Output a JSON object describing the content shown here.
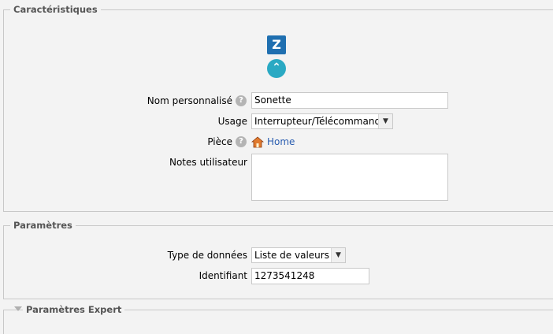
{
  "sections": {
    "caracteristiques": "Caractéristiques",
    "parametres": "Paramètres",
    "parametres_expert": "Paramètres Expert"
  },
  "icons": {
    "logo": "zibase-logo-icon",
    "collapse": "chevron-up-icon",
    "help": "help-icon",
    "room": "home-icon",
    "expand": "triangle-down-icon"
  },
  "colors": {
    "logo": "#1f6fb0",
    "collapse_button": "#2aa9c3",
    "link": "#2a5db0"
  },
  "form": {
    "nom_label": "Nom personnalisé",
    "nom_value": "Sonette",
    "usage_label": "Usage",
    "usage_value": "Interrupteur/Télécommande",
    "piece_label": "Pièce",
    "piece_value": "Home",
    "notes_label": "Notes utilisateur",
    "notes_value": ""
  },
  "params": {
    "type_label": "Type de données",
    "type_value": "Liste de valeurs",
    "id_label": "Identifiant",
    "id_value": "1273541248"
  }
}
